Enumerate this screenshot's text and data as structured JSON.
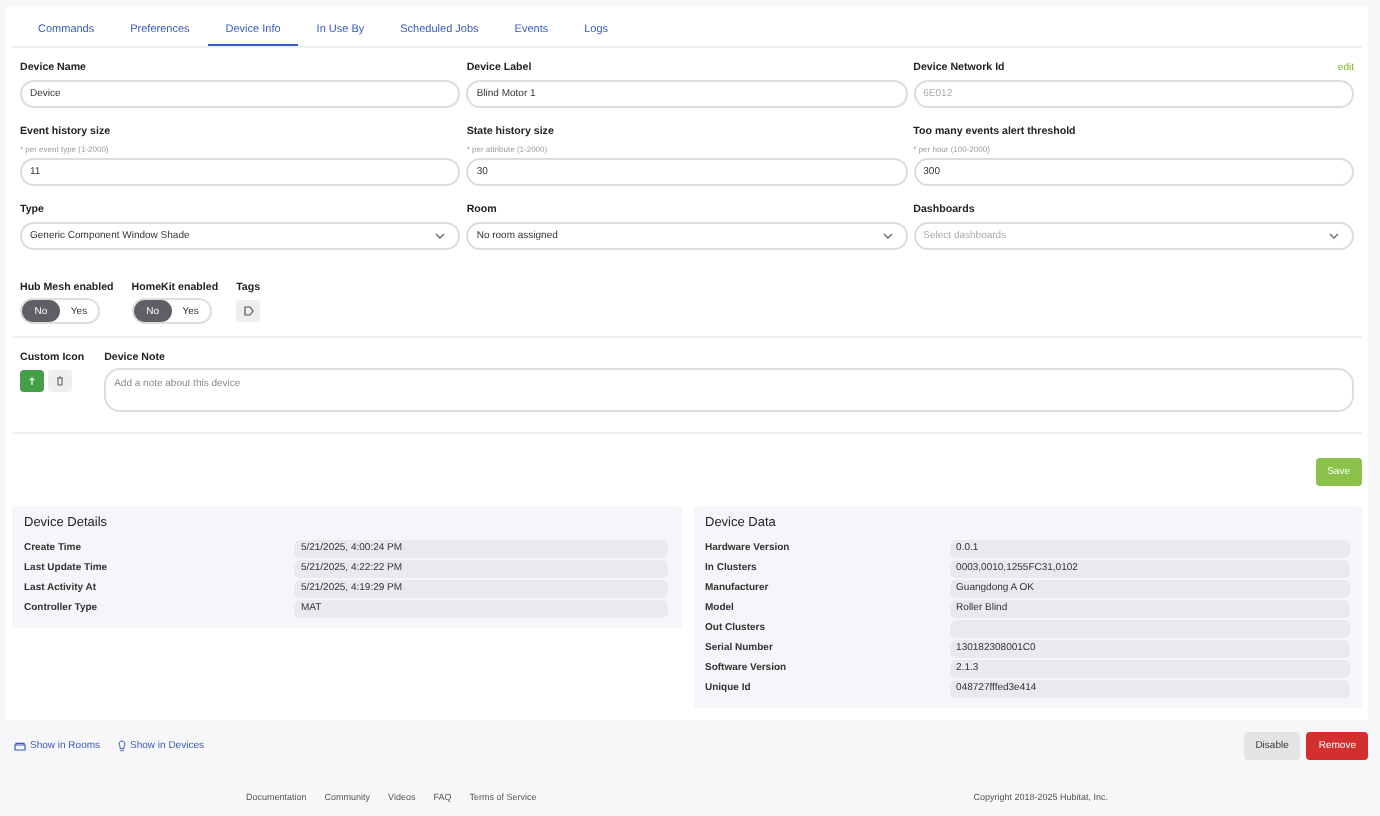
{
  "tabs": [
    {
      "label": "Commands",
      "selected": false
    },
    {
      "label": "Preferences",
      "selected": false
    },
    {
      "label": "Device Info",
      "selected": true
    },
    {
      "label": "In Use By",
      "selected": false
    },
    {
      "label": "Scheduled Jobs",
      "selected": false
    },
    {
      "label": "Events",
      "selected": false
    },
    {
      "label": "Logs",
      "selected": false
    }
  ],
  "fields": [
    {
      "kind": "input",
      "label": "Device Name",
      "value": "Device"
    },
    {
      "kind": "input",
      "label": "Device Label",
      "value": "Blind Motor 1"
    },
    {
      "kind": "input",
      "label": "Device Network Id",
      "value": "6E012",
      "disabled": true,
      "action": "edit"
    },
    {
      "kind": "input",
      "label": "Event history size",
      "hint": "* per event type (1-2000)",
      "value": "11"
    },
    {
      "kind": "input",
      "label": "State history size",
      "hint": "* per attribute (1-2000)",
      "value": "30"
    },
    {
      "kind": "input",
      "label": "Too many events alert threshold",
      "hint": "* per hour (100-2000)",
      "value": "300"
    },
    {
      "kind": "select",
      "label": "Type",
      "value": "Generic Component Window Shade"
    },
    {
      "kind": "select",
      "label": "Room",
      "value": "No room assigned"
    },
    {
      "kind": "select",
      "label": "Dashboards",
      "placeholder": "Select dashboards"
    }
  ],
  "toggles": [
    {
      "label": "Hub Mesh enabled",
      "options": [
        {
          "label": "No",
          "selected": true
        },
        {
          "label": "Yes",
          "selected": false
        }
      ]
    },
    {
      "label": "HomeKit enabled",
      "options": [
        {
          "label": "No",
          "selected": true
        },
        {
          "label": "Yes",
          "selected": false
        }
      ]
    }
  ],
  "tags_label": "Tags",
  "custom_icon_label": "Custom Icon",
  "note": {
    "label": "Device Note",
    "placeholder": "Add a note about this device"
  },
  "save_button": "Save",
  "device_details": {
    "title": "Device Details",
    "rows": [
      {
        "label": "Create Time",
        "value": "5/21/2025, 4:00:24 PM"
      },
      {
        "label": "Last Update Time",
        "value": "5/21/2025, 4:22:22 PM"
      },
      {
        "label": "Last Activity At",
        "value": "5/21/2025, 4:19:29 PM"
      },
      {
        "label": "Controller Type",
        "value": "MAT"
      }
    ]
  },
  "device_data": {
    "title": "Device Data",
    "rows": [
      {
        "label": "Hardware Version",
        "value": "0.0.1"
      },
      {
        "label": "In Clusters",
        "value": "0003,0010,1255FC31,0102"
      },
      {
        "label": "Manufacturer",
        "value": "Guangdong A OK"
      },
      {
        "label": "Model",
        "value": "Roller Blind"
      },
      {
        "label": "Out Clusters"
      },
      {
        "label": "Serial Number",
        "value": "130182308001C0"
      },
      {
        "label": "Software Version",
        "value": "2.1.3"
      },
      {
        "label": "Unique Id",
        "value": "048727fffed3e414"
      }
    ]
  },
  "links": [
    {
      "kind": "rooms",
      "label": "Show in Rooms"
    },
    {
      "kind": "devices",
      "label": "Show in Devices"
    }
  ],
  "actions": [
    {
      "kind": "neutral",
      "label": "Disable"
    },
    {
      "kind": "danger",
      "label": "Remove"
    }
  ],
  "footer_links": [
    "Documentation",
    "Community",
    "Videos",
    "FAQ",
    "Terms of Service"
  ],
  "copyright": "Copyright 2018-2025 Hubitat, Inc."
}
